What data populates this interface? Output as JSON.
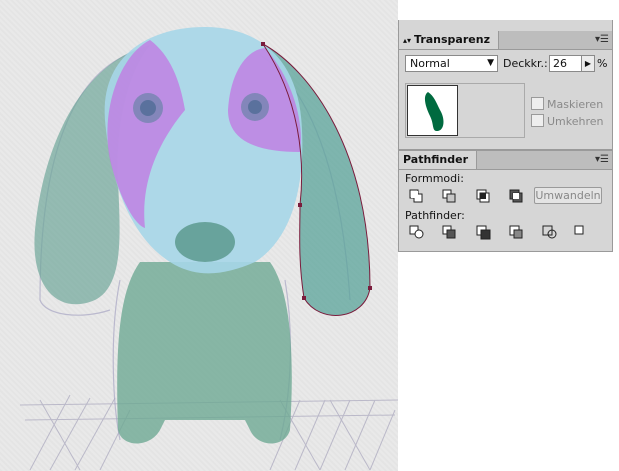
{
  "transparency_panel": {
    "tab_label": "Transparenz",
    "blend_mode": "Normal",
    "opacity_label": "Deckkr.:",
    "opacity_value": "26",
    "opacity_unit": "%",
    "mask_label": "Maskieren",
    "invert_label": "Umkehren",
    "thumbnail_color": "#006a3f"
  },
  "pathfinder_panel": {
    "tab_label": "Pathfinder",
    "shape_modes_label": "Formmodi:",
    "expand_label": "Umwandeln",
    "pathfinders_label": "Pathfinder:",
    "shape_mode_icons": [
      "unite-icon",
      "minus-front-icon",
      "intersect-icon",
      "exclude-icon"
    ],
    "pathfinder_icons": [
      "divide-icon",
      "trim-icon",
      "merge-icon",
      "crop-icon",
      "outline-icon",
      "minus-back-icon"
    ]
  },
  "dock": {
    "collapse_icon": "double-chevron-left-icon",
    "close_icon": "close-icon"
  },
  "artwork_colors": {
    "ears": "#6fa79a",
    "head": "#a6d6e8",
    "patches": "#c07ce2",
    "body": "#6ea994",
    "selected_path": "#7a1c3c"
  }
}
